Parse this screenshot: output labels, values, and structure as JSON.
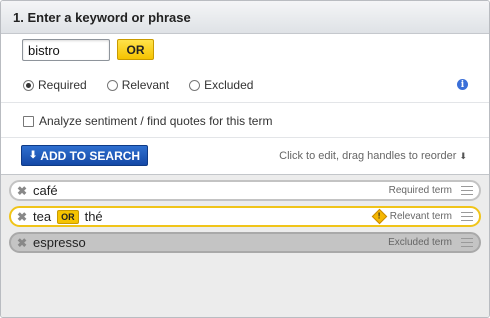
{
  "header": {
    "title": "1. Enter a keyword or phrase"
  },
  "keyword": {
    "value": "bistro",
    "or_label": "OR"
  },
  "radios": [
    {
      "label": "Required",
      "checked": true
    },
    {
      "label": "Relevant",
      "checked": false
    },
    {
      "label": "Excluded",
      "checked": false
    }
  ],
  "info_icon": "info-icon",
  "sentiment": {
    "label": "Analyze sentiment / find quotes for this term",
    "checked": false
  },
  "add_button": {
    "label": "ADD TO SEARCH",
    "icon": "arrow-down-icon"
  },
  "hint": {
    "text": "Click to edit, drag handles to reorder"
  },
  "terms": [
    {
      "words": [
        "café"
      ],
      "status": "Required term",
      "type": "required"
    },
    {
      "words": [
        "tea",
        "thé"
      ],
      "or_label": "OR",
      "status": "Relevant term",
      "type": "relevant"
    },
    {
      "words": [
        "espresso"
      ],
      "status": "Excluded term",
      "type": "excluded"
    }
  ],
  "colors": {
    "accent_blue": "#1448a6",
    "or_yellow": "#f5c300",
    "relevant_border": "#f0c419"
  }
}
